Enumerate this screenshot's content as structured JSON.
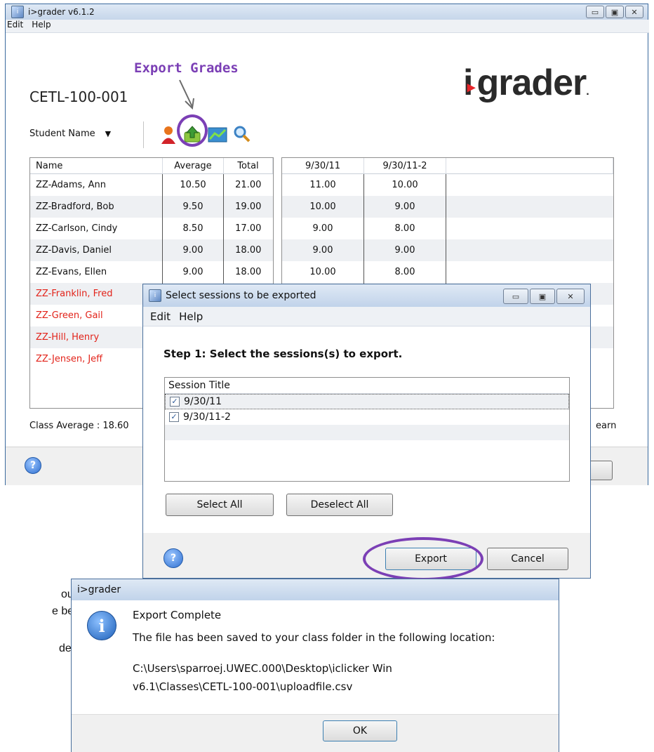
{
  "main_window": {
    "title": "i>grader v6.1.2",
    "menu": [
      "Edit",
      "Help"
    ],
    "class_name": "CETL-100-001",
    "logo_text": "igrader",
    "sort_label": "Student Name",
    "columns": [
      "Name",
      "Average",
      "Total"
    ],
    "session_columns": [
      "9/30/11",
      "9/30/11-2"
    ],
    "rows": [
      {
        "name": "ZZ-Adams, Ann",
        "average": "10.50",
        "total": "21.00",
        "s1": "11.00",
        "s2": "10.00"
      },
      {
        "name": "ZZ-Bradford, Bob",
        "average": "9.50",
        "total": "19.00",
        "s1": "10.00",
        "s2": "9.00"
      },
      {
        "name": "ZZ-Carlson, Cindy",
        "average": "8.50",
        "total": "17.00",
        "s1": "9.00",
        "s2": "8.00"
      },
      {
        "name": "ZZ-Davis, Daniel",
        "average": "9.00",
        "total": "18.00",
        "s1": "9.00",
        "s2": "9.00"
      },
      {
        "name": "ZZ-Evans, Ellen",
        "average": "9.00",
        "total": "18.00",
        "s1": "10.00",
        "s2": "8.00"
      },
      {
        "name": "ZZ-Franklin, Fred"
      },
      {
        "name": "ZZ-Green, Gail"
      },
      {
        "name": "ZZ-Hill, Henry"
      },
      {
        "name": "ZZ-Jensen, Jeff"
      }
    ],
    "class_average": "Class Average : 18.60",
    "right_partial_text": "earn"
  },
  "annotation": {
    "label": "Export Grades",
    "color": "#7b3fb5"
  },
  "export_dialog": {
    "title": "Select sessions to be exported",
    "menu": [
      "Edit",
      "Help"
    ],
    "step_text": "Step 1: Select the sessions(s) to export.",
    "list_header": "Session Title",
    "sessions": [
      {
        "title": "9/30/11",
        "checked": true
      },
      {
        "title": "9/30/11-2",
        "checked": true
      }
    ],
    "select_all": "Select All",
    "deselect_all": "Deselect All",
    "export": "Export",
    "cancel": "Cancel"
  },
  "complete_dialog": {
    "title": "i>grader",
    "heading": "Export Complete",
    "message": "The file has been saved to your class folder in the following location:",
    "path_line1": "C:\\Users\\sparroej.UWEC.000\\Desktop\\iclicker Win",
    "path_line2": "v6.1\\Classes\\CETL-100-001\\uploadfile.csv",
    "ok": "OK"
  },
  "background_text": [
    "ou",
    "e been",
    "der in"
  ],
  "icons": [
    "student-icon",
    "export-icon",
    "chart-icon",
    "search-icon",
    "help-icon",
    "info-icon"
  ]
}
